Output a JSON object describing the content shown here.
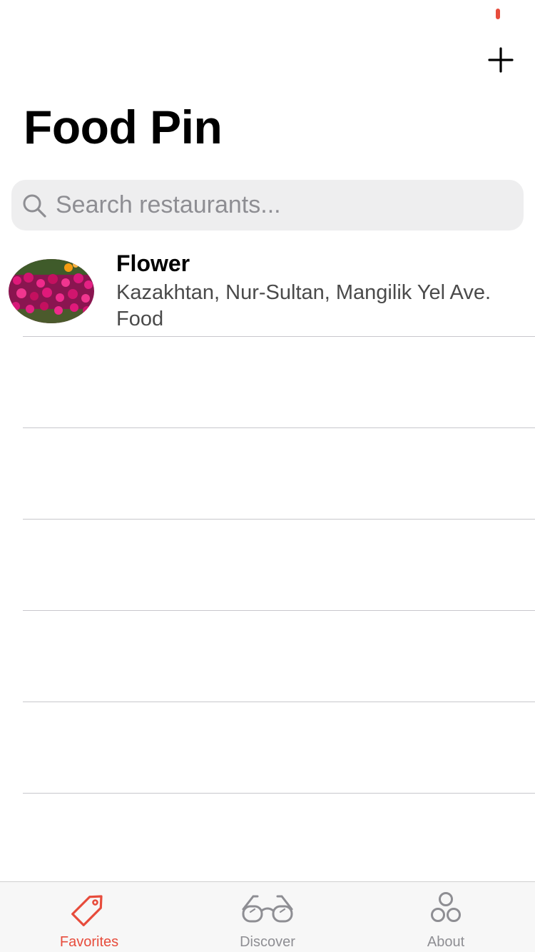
{
  "header": {
    "title": "Food Pin",
    "add_icon": "plus-icon"
  },
  "colors": {
    "accent": "#e74c3c",
    "inactive": "#8e8e93",
    "search_bg": "#eeeeef",
    "separator": "#c8c7cc"
  },
  "search": {
    "placeholder": "Search restaurants...",
    "value": "",
    "icon": "magnifying-glass-icon"
  },
  "restaurants": [
    {
      "name": "Flower",
      "location": "Kazakhtan, Nur-Sultan, Mangilik Yel Ave.",
      "type": "Food",
      "thumbnail": "pink-flowers-photo"
    }
  ],
  "tab_bar": {
    "selected_index": 0,
    "tabs": [
      {
        "label": "Favorites",
        "icon": "tag-icon"
      },
      {
        "label": "Discover",
        "icon": "glasses-icon"
      },
      {
        "label": "About",
        "icon": "circles-icon"
      }
    ]
  }
}
